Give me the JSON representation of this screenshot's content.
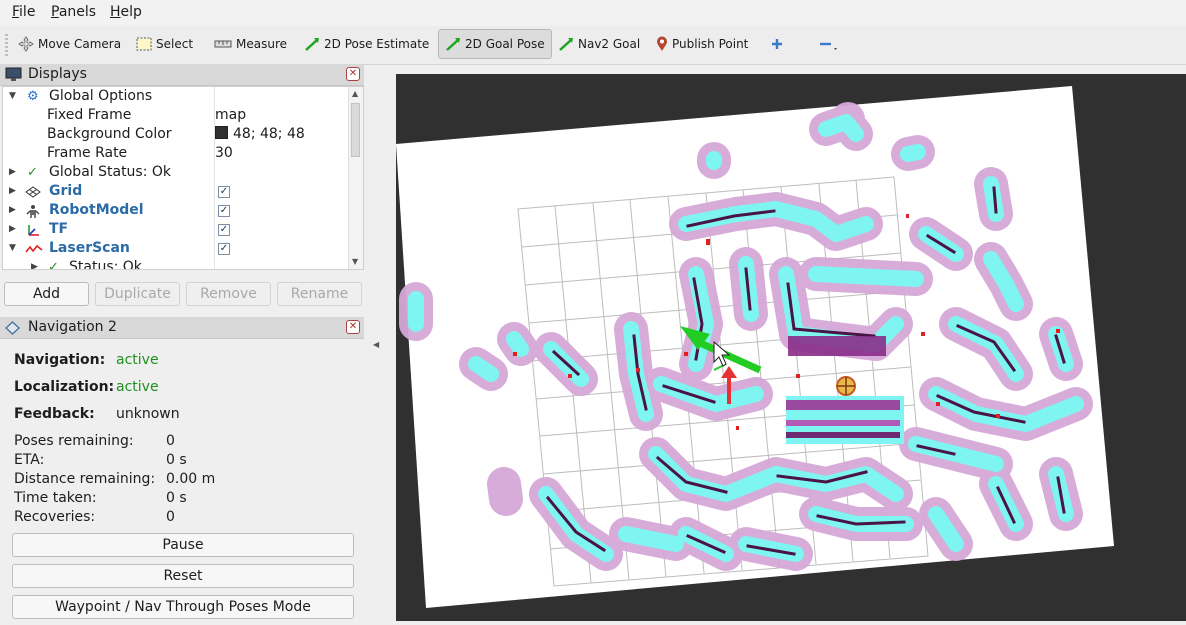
{
  "menu": {
    "items": [
      "File",
      "Panels",
      "Help"
    ]
  },
  "toolbar": {
    "tools": [
      {
        "label": "Move Camera",
        "icon": "move-camera-icon"
      },
      {
        "label": "Select",
        "icon": "select-icon"
      },
      {
        "label": "Measure",
        "icon": "measure-icon"
      },
      {
        "label": "2D Pose Estimate",
        "icon": "pose-estimate-icon"
      },
      {
        "label": "2D Goal Pose",
        "icon": "goal-pose-icon",
        "active": true
      },
      {
        "label": "Nav2 Goal",
        "icon": "nav2-goal-icon"
      },
      {
        "label": "Publish Point",
        "icon": "publish-point-icon"
      }
    ],
    "extra_icons": [
      "add-tool-icon",
      "remove-tool-icon"
    ]
  },
  "displays": {
    "title": "Displays",
    "rows": [
      {
        "label": "Global Options",
        "icon": "gear-icon",
        "expanded": true
      },
      {
        "label": "Fixed Frame",
        "value": "map"
      },
      {
        "label": "Background Color",
        "value": "48; 48; 48"
      },
      {
        "label": "Frame Rate",
        "value": "30"
      },
      {
        "label": "Global Status: Ok",
        "icon": "check-icon"
      },
      {
        "label": "Grid",
        "icon": "grid-icon",
        "checked": true
      },
      {
        "label": "RobotModel",
        "icon": "robot-model-icon",
        "checked": true
      },
      {
        "label": "TF",
        "icon": "tf-icon",
        "checked": true
      },
      {
        "label": "LaserScan",
        "icon": "laser-scan-icon",
        "checked": true,
        "expanded": true
      },
      {
        "label": "Status: Ok",
        "icon": "check-icon"
      }
    ],
    "buttons": {
      "add": "Add",
      "duplicate": "Duplicate",
      "remove": "Remove",
      "rename": "Rename"
    }
  },
  "navigation": {
    "title": "Navigation 2",
    "navigation_label": "Navigation:",
    "navigation_value": "active",
    "localization_label": "Localization:",
    "localization_value": "active",
    "feedback_label": "Feedback:",
    "feedback_value": "unknown",
    "stats": [
      {
        "label": "Poses remaining:",
        "value": "0"
      },
      {
        "label": "ETA:",
        "value": "0 s"
      },
      {
        "label": "Distance remaining:",
        "value": "0.00 m"
      },
      {
        "label": "Time taken:",
        "value": "0 s"
      },
      {
        "label": "Recoveries:",
        "value": "0"
      }
    ],
    "buttons": {
      "pause": "Pause",
      "reset": "Reset",
      "waypoint": "Waypoint / Nav Through Poses Mode"
    }
  },
  "colors": {
    "background": "#303030",
    "costmap_inner": "#7ff5f2",
    "costmap_outer": "#d6a8d8",
    "obstacle": "#4a1445",
    "pose_arrow": "#22cc22",
    "marker_arrow": "#e63232"
  }
}
